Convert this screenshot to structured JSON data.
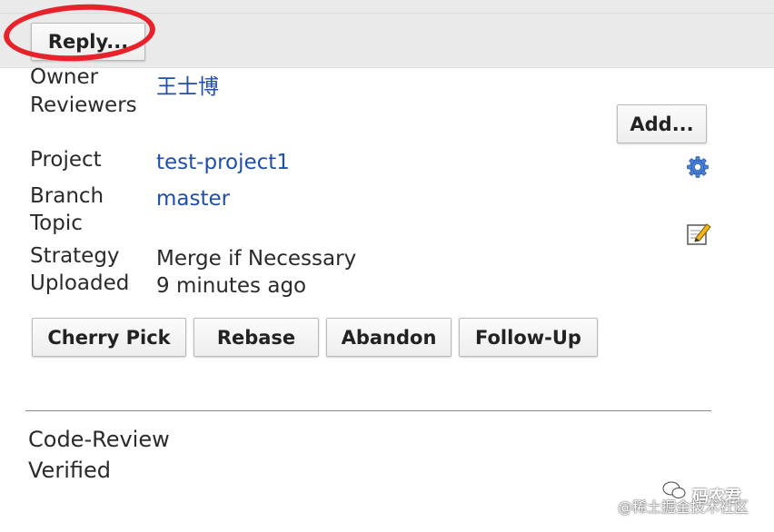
{
  "toolbar": {
    "reply_label": "Reply..."
  },
  "info": {
    "owner_label": "Owner",
    "owner_value": "王士博",
    "reviewers_label": "Reviewers",
    "add_label": "Add...",
    "project_label": "Project",
    "project_value": "test-project1",
    "branch_label": "Branch",
    "branch_value": "master",
    "topic_label": "Topic",
    "strategy_label": "Strategy",
    "strategy_value": "Merge if Necessary",
    "uploaded_label": "Uploaded",
    "uploaded_value": "9 minutes ago"
  },
  "actions": {
    "cherry_pick": "Cherry Pick",
    "rebase": "Rebase",
    "abandon": "Abandon",
    "follow_up": "Follow-Up"
  },
  "labels": {
    "code_review": "Code-Review",
    "verified": "Verified"
  },
  "watermark": {
    "site": "@稀土掘金技术社区",
    "badge": "码农君"
  },
  "icons": {
    "settings": "gear-icon",
    "edit": "edit-icon"
  },
  "colors": {
    "link": "#1f4fa8",
    "highlight": "#e8222b"
  }
}
